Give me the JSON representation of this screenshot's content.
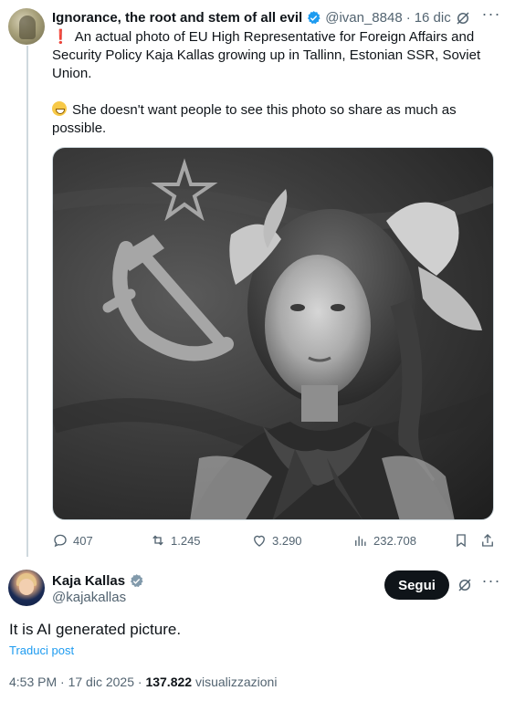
{
  "quoted_post": {
    "author_name": "Ignorance, the root and stem of all evil",
    "author_handle": "@ivan_8848",
    "separator": "·",
    "date": "16 dic",
    "line1": "An actual photo of EU High Representative for Foreign Affairs and Security Policy Kaja Kallas growing up in Tallinn, Estonian SSR, Soviet Union.",
    "line2": "She doesn't want people to see this photo so share as much as possible.",
    "exclamation": "❗",
    "stats": {
      "replies": "407",
      "reposts": "1.245",
      "likes": "3.290",
      "views": "232.708"
    }
  },
  "main_post": {
    "author_name": "Kaja Kallas",
    "author_handle": "@kajakallas",
    "follow_label": "Segui",
    "text": "It is AI generated picture.",
    "translate_label": "Traduci post",
    "time": "4:53 PM",
    "separator": "·",
    "date": "17 dic 2025",
    "views_count": "137.822",
    "views_label": "visualizzazioni"
  },
  "icons": {
    "verified": "verified-badge-icon",
    "grok": "grok-icon",
    "more": "more-icon",
    "reply": "reply-icon",
    "repost": "repost-icon",
    "like": "like-icon",
    "views": "views-icon",
    "bookmark": "bookmark-icon",
    "share": "share-icon"
  },
  "colors": {
    "verified": "#1d9bf0",
    "link": "#1d9bf0",
    "secondary_text": "#536471",
    "follow_button": "#0f1419"
  }
}
